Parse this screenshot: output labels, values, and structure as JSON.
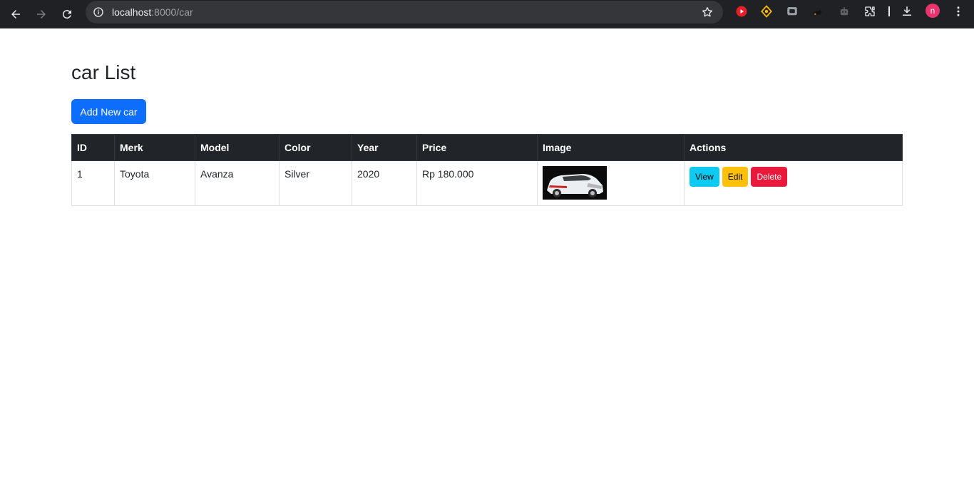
{
  "browser": {
    "url_host": "localhost",
    "url_rest": ":8000/car",
    "avatar_letter": "n"
  },
  "page": {
    "title": "car List",
    "add_button_label": "Add New car"
  },
  "table": {
    "headers": [
      "ID",
      "Merk",
      "Model",
      "Color",
      "Year",
      "Price",
      "Image",
      "Actions"
    ],
    "rows": [
      {
        "id": "1",
        "merk": "Toyota",
        "model": "Avanza",
        "color": "Silver",
        "year": "2020",
        "price": "Rp 180.000",
        "image": "car-photo",
        "actions": {
          "view": "View",
          "edit": "Edit",
          "delete": "Delete"
        }
      }
    ]
  }
}
